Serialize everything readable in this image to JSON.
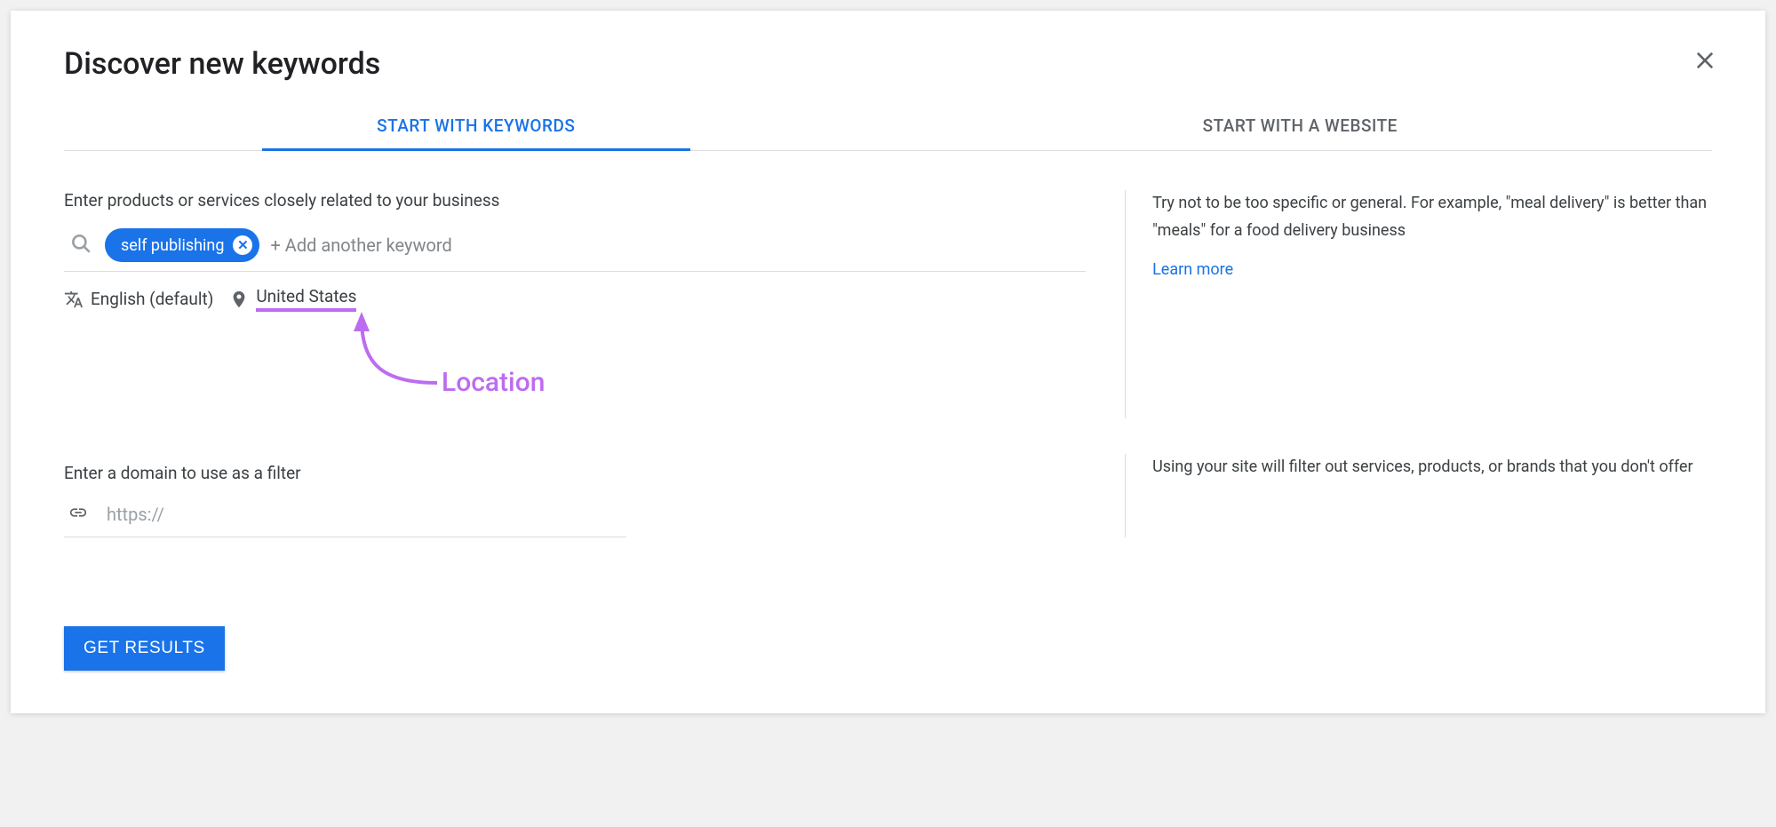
{
  "header": {
    "title": "Discover new keywords"
  },
  "tabs": {
    "keywords": "START WITH KEYWORDS",
    "website": "START WITH A WEBSITE"
  },
  "keywords_section": {
    "label": "Enter products or services closely related to your business",
    "chip": "self publishing",
    "add_placeholder": "+ Add another keyword"
  },
  "settings": {
    "language": "English (default)",
    "location": "United States"
  },
  "annotation": {
    "label": "Location"
  },
  "tips": {
    "keywords_tip": "Try not to be too specific or general. For example, \"meal delivery\" is better than \"meals\" for a food delivery business",
    "learn_more": "Learn more",
    "domain_tip": "Using your site will filter out services, products, or brands that you don't offer"
  },
  "domain_section": {
    "label": "Enter a domain to use as a filter",
    "placeholder": "https://"
  },
  "actions": {
    "get_results": "GET RESULTS"
  }
}
